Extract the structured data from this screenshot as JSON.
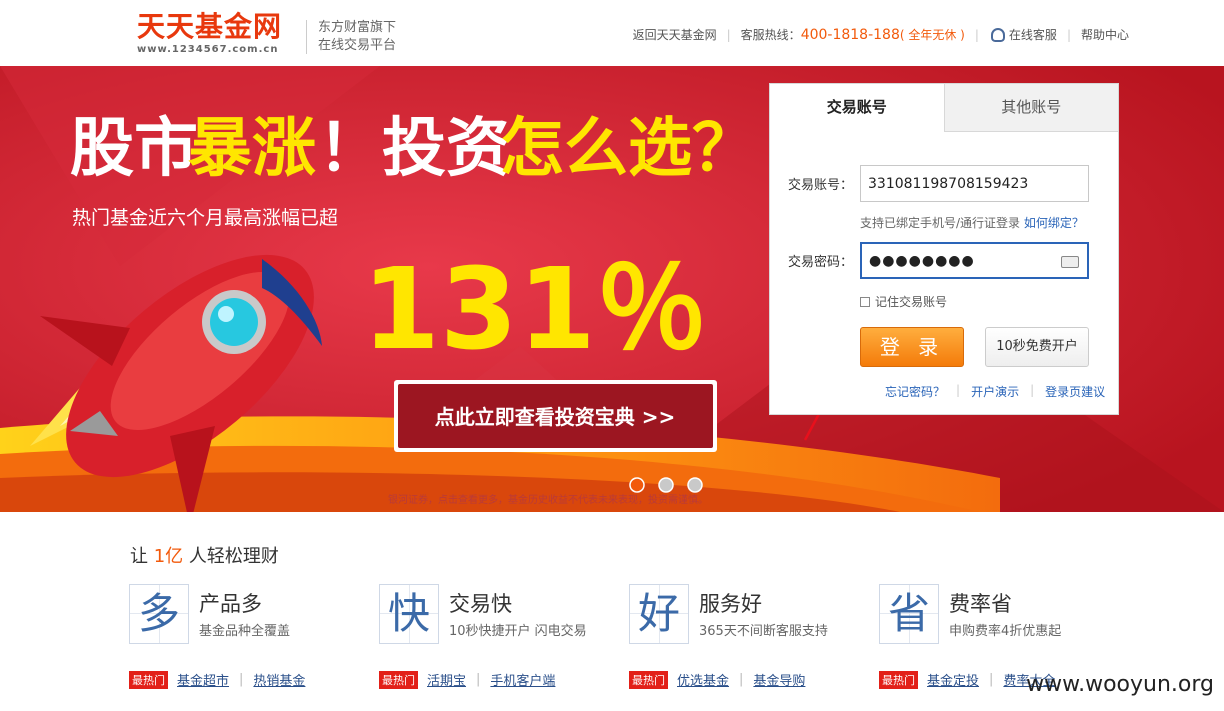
{
  "header": {
    "logo_name": "天天基金网",
    "logo_url": "www.1234567.com.cn",
    "tagline_1": "东方财富旗下",
    "tagline_2": "在线交易平台",
    "nav_back": "返回天天基金网",
    "hotline_label": "客服热线：",
    "hotline_number": "400-1818-188",
    "hotline_note": "( 全年无休 )",
    "online_service": "在线客服",
    "help_center": "帮助中心"
  },
  "banner": {
    "headline_white_1": "股市",
    "headline_yellow_1": "暴涨",
    "headline_white_2": "！投资",
    "headline_yellow_2": "怎么选？",
    "subline": "热门基金近六个月最高涨幅已超",
    "big_number": "131％",
    "cta_button": "点此立即查看投资宝典 >>",
    "disclaimer": "银河证券，点击查看更多，基金历史收益不代表未来表现，投资需谨慎。",
    "slides": 3,
    "active_slide": 1
  },
  "login": {
    "tab_active": "交易账号",
    "tab_other": "其他账号",
    "account_label": "交易账号：",
    "account_value": "331081198708159423",
    "hint_text": "支持已绑定手机号/通行证登录",
    "hint_link": "如何绑定？",
    "password_label": "交易密码：",
    "password_value": "●●●●●●●●",
    "remember_label": "记住交易账号",
    "login_button": "登 录",
    "open_button": "10秒免费开户",
    "link_forgot": "忘记密码？",
    "link_demo": "开户演示",
    "link_suggest": "登录页建议"
  },
  "features": {
    "title_pre": "让",
    "title_hl": "1亿",
    "title_post": "人轻松理财",
    "items": [
      {
        "char": "多",
        "name": "产品多",
        "desc": "基金品种全覆盖",
        "badge": "最热门",
        "link1": "基金超市",
        "link2": "热销基金"
      },
      {
        "char": "快",
        "name": "交易快",
        "desc": "10秒快捷开户 闪电交易",
        "badge": "最热门",
        "link1": "活期宝",
        "link2": "手机客户端"
      },
      {
        "char": "好",
        "name": "服务好",
        "desc": "365天不间断客服支持",
        "badge": "最热门",
        "link1": "优选基金",
        "link2": "基金导购"
      },
      {
        "char": "省",
        "name": "费率省",
        "desc": "申购费率4折优惠起",
        "badge": "最热门",
        "link1": "基金定投",
        "link2": "费率大全"
      }
    ]
  },
  "watermark": "www.wooyun.org",
  "colors": {
    "brand": "#e8380d",
    "banner": "#c8202e",
    "accent": "#f25a0c",
    "link": "#2a64b8",
    "yellow": "#ffe600"
  }
}
